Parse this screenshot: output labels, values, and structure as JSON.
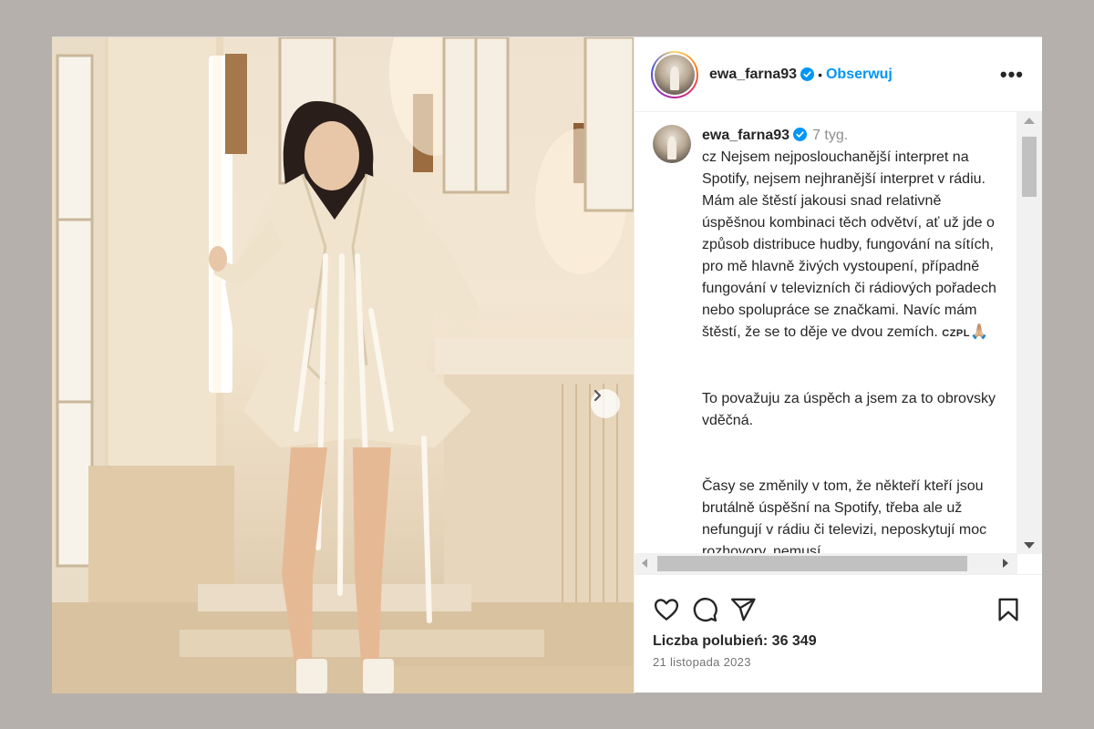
{
  "post": {
    "username": "ewa_farna93",
    "follow_label": "Obserwuj",
    "separator": "•",
    "more_label": "•••",
    "caption": {
      "username": "ewa_farna93",
      "time": "7 tyg.",
      "paragraphs": [
        "cz Nejsem nejposlouchanější interpret na Spotify, nejsem nejhranější interpret v rádiu. Mám ale štěstí jakousi snad relativně úspěšnou kombinaci těch odvětví, ať už jde o způsob distribuce hudby, fungování na sítích, pro mě hlavně živých vystoupení, případně fungování v televizních či rádiových pořadech nebo spolupráce se značkami. Navíc mám štěstí, že se to děje ve dvou zemích.",
        "To považuju za úspěch a jsem za to obrovsky vděčná.",
        "Časy se změnily v tom, že někteří kteří jsou brutálně úspěšní na Spotify, třeba ale už nefungují v rádiu či televizi, neposkytují moc rozhovory, nemusí"
      ],
      "flags_text": "CZPL",
      "emoji": "🙏🏼"
    },
    "likes_text": "Liczba polubień: 36 349",
    "date_text": "21 listopada 2023",
    "accent_color": "#0095f6"
  },
  "icons": {
    "verified": "verified-badge-icon",
    "next": "chevron-right-icon",
    "like": "heart-icon",
    "comment": "comment-icon",
    "share": "paper-plane-icon",
    "save": "bookmark-icon"
  }
}
